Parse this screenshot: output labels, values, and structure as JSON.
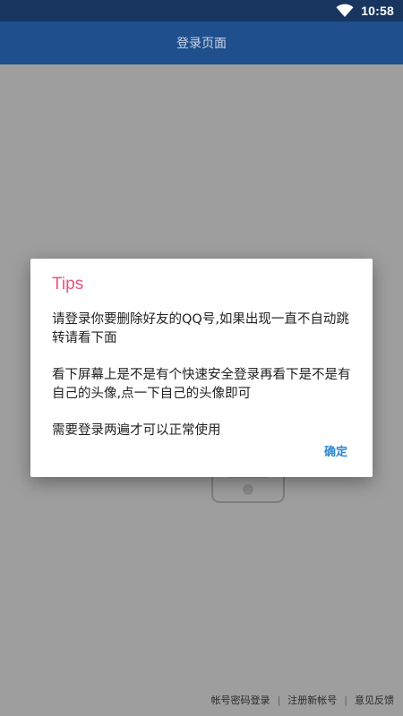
{
  "status_bar": {
    "time": "10:58",
    "wifi_icon": "wifi-icon"
  },
  "app_bar": {
    "title": "登录页面"
  },
  "dialog": {
    "title": "Tips",
    "messages": [
      "请登录你要删除好友的QQ号,如果出现一直不自动跳转请看下面",
      "看下屏幕上是不是有个快速安全登录再看下是不是有自己的头像,点一下自己的头像即可",
      "需要登录两遍才可以正常使用"
    ],
    "confirm_label": "确定"
  },
  "footer": {
    "links": [
      "帐号密码登录",
      "注册新帐号",
      "意见反馈"
    ],
    "separator": "|"
  },
  "colors": {
    "status_bar": "#17355f",
    "app_bar": "#1f4f8c",
    "title_accent": "#e9537b",
    "button_accent": "#2a86d4"
  }
}
